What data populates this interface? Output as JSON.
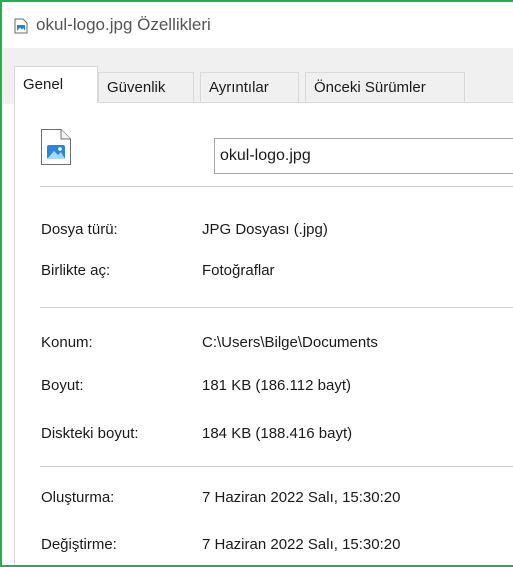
{
  "window": {
    "title": "okul-logo.jpg Özellikleri",
    "accent_border": "#22b14c"
  },
  "tabs": [
    {
      "label": "Genel",
      "active": true
    },
    {
      "label": "Güvenlik",
      "active": false
    },
    {
      "label": "Ayrıntılar",
      "active": false
    },
    {
      "label": "Önceki Sürümler",
      "active": false
    }
  ],
  "general": {
    "file_icon": "image-file-icon",
    "filename": "okul-logo.jpg",
    "type": {
      "label": "Dosya türü:",
      "value": "JPG Dosyası (.jpg)"
    },
    "open_with": {
      "label": "Birlikte aç:",
      "value": "Fotoğraflar"
    },
    "location": {
      "label": "Konum:",
      "value": "C:\\Users\\Bilge\\Documents"
    },
    "size": {
      "label": "Boyut:",
      "value": "181 KB (186.112 bayt)"
    },
    "size_on_disk": {
      "label": "Diskteki boyut:",
      "value": "184 KB (188.416 bayt)"
    },
    "created": {
      "label": "Oluşturma:",
      "value": "7 Haziran 2022 Salı, 15:30:20"
    },
    "modified": {
      "label": "Değiştirme:",
      "value": "7 Haziran 2022 Salı, 15:30:20"
    }
  }
}
